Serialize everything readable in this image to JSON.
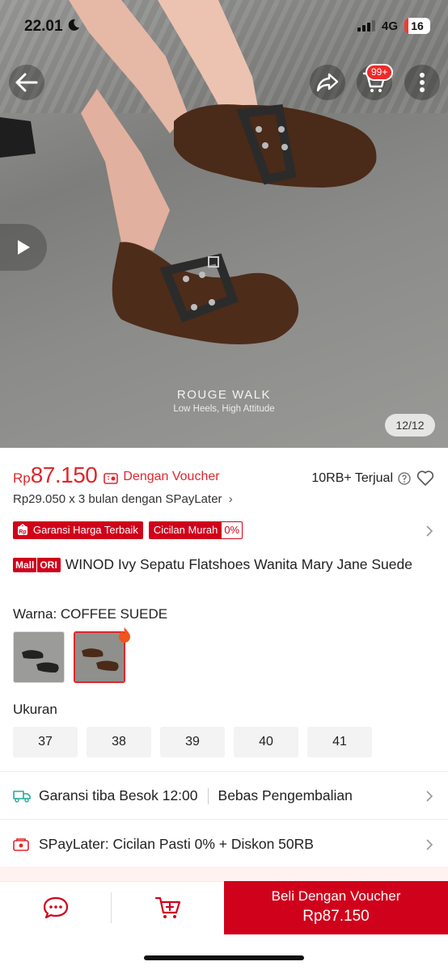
{
  "status_bar": {
    "time": "22.01",
    "network": "4G",
    "battery": "16"
  },
  "header": {
    "cart_badge": "99+"
  },
  "hero": {
    "brand": "ROUGE WALK",
    "tagline": "Low Heels, High Attitude",
    "image_counter": "12/12"
  },
  "price": {
    "currency": "Rp",
    "value": "87.150",
    "voucher_label": "Dengan Voucher",
    "sold_label": "10RB+ Terjual",
    "spaylater": "Rp29.050 x 3 bulan dengan SPayLater"
  },
  "badges": {
    "guarantee": "Garansi Harga Terbaik",
    "installment": "Cicilan Murah",
    "installment_rate": "0%"
  },
  "product": {
    "mall_tag": "Mall",
    "ori_tag": "ORI",
    "title": "WINOD Ivy Sepatu Flatshoes Wanita Mary Jane Suede"
  },
  "variant": {
    "color_label": "Warna: COFFEE SUEDE",
    "size_label": "Ukuran",
    "sizes": [
      "37",
      "38",
      "39",
      "40",
      "41"
    ]
  },
  "shipping": {
    "guarantee": "Garansi tiba Besok 12:00",
    "returns": "Bebas Pengembalian"
  },
  "spaylater_promo": "SPayLater: Cicilan Pasti 0% + Diskon 50RB",
  "bottom_bar": {
    "buy_label": "Beli Dengan Voucher",
    "buy_price": "Rp87.150"
  },
  "colors": {
    "accent": "#d0011b",
    "price_red": "#e0262c",
    "shipping_green": "#26aa99"
  }
}
